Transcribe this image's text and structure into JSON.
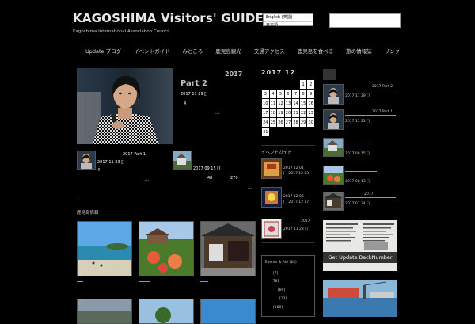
{
  "header": {
    "title": "KAGOSHIMA Visitors' GUIDE",
    "subtitle": "Kagoshima International Association Council",
    "lang_options": [
      "English (英語)",
      "日本語"
    ]
  },
  "nav": [
    "Update ブログ",
    "イベントガイド",
    "みどころ",
    "鹿児島観光",
    "交通アクセス",
    "鹿児島を食べる",
    "旅の情報誌",
    "リンク"
  ],
  "featured": {
    "heading": "Part 2",
    "year": "2017",
    "date": "2017 11 29 []",
    "num": "4",
    "ellipsis": "…"
  },
  "sub_posts": [
    {
      "title": "2017 Part 1",
      "date": "2017 11 23 []",
      "num": "4",
      "ellipsis": "…"
    },
    {
      "date": "2017 09 15 []",
      "a": "48",
      "b": "270",
      "ellipsis": "…"
    }
  ],
  "section_label": "鹿児島情報",
  "calendar": {
    "title": "2017 12",
    "rows": [
      [
        "",
        "",
        "",
        "",
        "",
        "1",
        "2"
      ],
      [
        "3",
        "4",
        "5",
        "6",
        "7",
        "8",
        "9"
      ],
      [
        "10",
        "11",
        "12",
        "13",
        "14",
        "15",
        "16"
      ],
      [
        "17",
        "18",
        "19",
        "20",
        "21",
        "22",
        "23"
      ],
      [
        "24",
        "25",
        "26",
        "27",
        "28",
        "29",
        "30"
      ],
      [
        "31",
        "",
        "",
        "",
        "",
        "",
        ""
      ]
    ]
  },
  "event_guide": {
    "label": "イベントガイド",
    "items": [
      {
        "line1": "2017 12 01",
        "line2": "[ ] 2017 12 03"
      },
      {
        "line1": "2017 12 03",
        "line2": "[ ] 2017 12 17"
      },
      {
        "line1": "2017",
        "line2": "2017 11 28 []"
      }
    ]
  },
  "categories": {
    "heading": "Events & Ate (24)",
    "items": [
      "[7]",
      "[78]",
      "[89]",
      "[13]",
      "[160]"
    ]
  },
  "right_posts": [
    {
      "title": "2017 Part 2",
      "date": "2017 11 29 []"
    },
    {
      "title": "2017 Part 1",
      "date": "2017 11 23 []"
    },
    {
      "title": "",
      "date": "2017 09 15 []"
    },
    {
      "title": "",
      "date": "2017 08 13 []"
    },
    {
      "title": "2017",
      "date": "2017 07 24 []"
    }
  ],
  "backnumber_label": "Get Update BackNumber",
  "colors": {
    "bg": "#000000",
    "link": "#6aa0d8"
  }
}
